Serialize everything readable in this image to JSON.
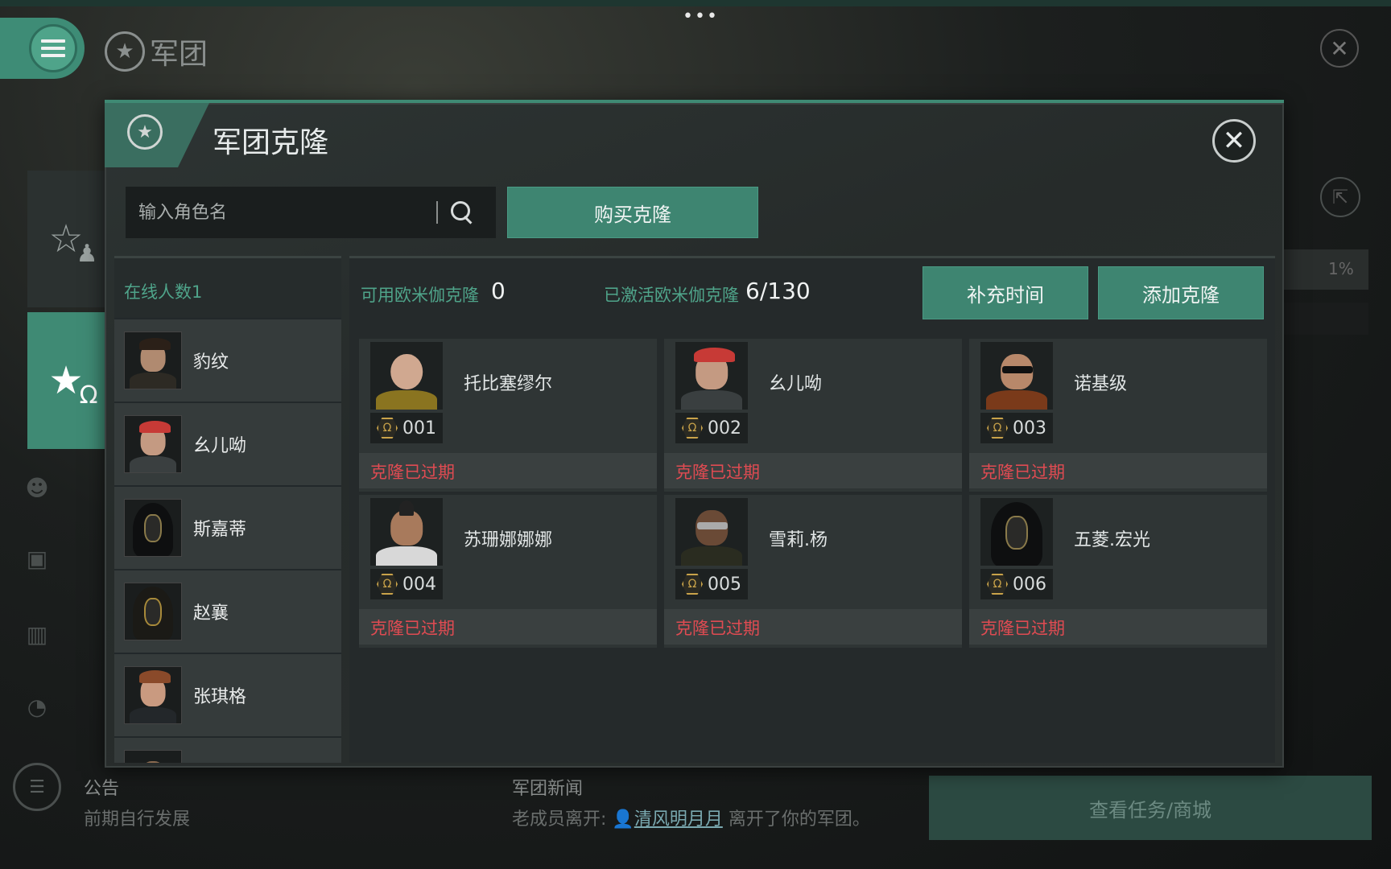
{
  "background": {
    "title": "军团",
    "notice_title": "公告",
    "notice_text": "前期自行发展",
    "news_title": "军团新闻",
    "news_prefix": "老成员离开: ",
    "news_who": "清风明月月",
    "news_suffix": " 离开了你的军团。",
    "task_button": "查看任务/商城",
    "right_percent": "1%"
  },
  "modal": {
    "title": "军团克隆",
    "search_placeholder": "输入角色名",
    "buy_button": "购买克隆",
    "online_label": "在线人数1",
    "available_label": "可用欧米伽克隆",
    "available_value": "0",
    "activated_label": "已激活欧米伽克隆",
    "activated_value": "6/130",
    "fill_button": "补充时间",
    "add_button": "添加克隆"
  },
  "members": [
    {
      "name": "豹纹",
      "avatar": "male-dark-hair"
    },
    {
      "name": "幺儿呦",
      "avatar": "female-red-cap"
    },
    {
      "name": "斯嘉蒂",
      "avatar": "hooded-mask"
    },
    {
      "name": "赵襄",
      "avatar": "hooded-mask"
    },
    {
      "name": "张琪格",
      "avatar": "female-auburn"
    }
  ],
  "clones": [
    {
      "name": "托比塞缪尔",
      "number": "001",
      "status": "克隆已过期",
      "avatar": "bald-male"
    },
    {
      "name": "幺儿呦",
      "number": "002",
      "status": "克隆已过期",
      "avatar": "female-red-cap"
    },
    {
      "name": "诺基级",
      "number": "003",
      "status": "克隆已过期",
      "avatar": "male-sunglasses"
    },
    {
      "name": "苏珊娜娜娜",
      "number": "004",
      "status": "克隆已过期",
      "avatar": "male-mohawk"
    },
    {
      "name": "雪莉.杨",
      "number": "005",
      "status": "克隆已过期",
      "avatar": "female-goggles"
    },
    {
      "name": "五菱.宏光",
      "number": "006",
      "status": "克隆已过期",
      "avatar": "hooded-mask"
    }
  ],
  "colors": {
    "accent": "#3e8571",
    "expired": "#e04b52",
    "omega_gold": "#c9a34a"
  }
}
